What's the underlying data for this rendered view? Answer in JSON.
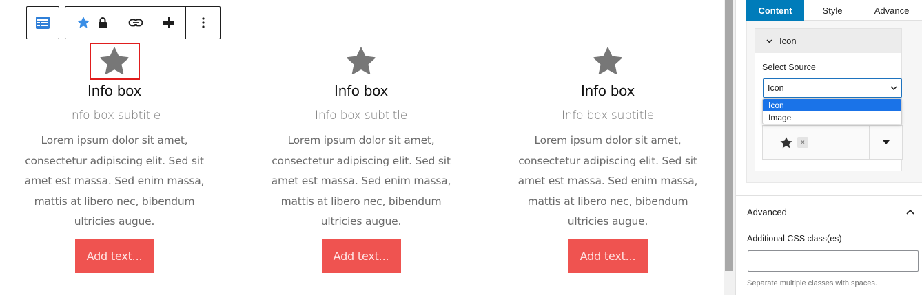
{
  "toolbar": {
    "block_icon": "block-table-icon",
    "buttons": [
      "star-icon",
      "lock-icon",
      "link-icon",
      "align-icon",
      "more-vertical-icon"
    ]
  },
  "infoboxes": [
    {
      "title": "Info box",
      "subtitle": "Info box subtitle",
      "description": "Lorem ipsum dolor sit amet, consectetur adipiscing elit. Sed sit amet est massa. Sed enim massa, mattis at libero nec, bibendum ultricies augue.",
      "button_label": "Add text...",
      "selected": true
    },
    {
      "title": "Info box",
      "subtitle": "Info box subtitle",
      "description": "Lorem ipsum dolor sit amet, consectetur adipiscing elit. Sed sit amet est massa. Sed enim massa, mattis at libero nec, bibendum ultricies augue.",
      "button_label": "Add text...",
      "selected": false
    },
    {
      "title": "Info box",
      "subtitle": "Info box subtitle",
      "description": "Lorem ipsum dolor sit amet, consectetur adipiscing elit. Sed sit amet est massa. Sed enim massa, mattis at libero nec, bibendum ultricies augue.",
      "button_label": "Add text...",
      "selected": false
    }
  ],
  "sidebar": {
    "tabs": [
      {
        "label": "Content",
        "active": true
      },
      {
        "label": "Style",
        "active": false
      },
      {
        "label": "Advance",
        "active": false
      }
    ],
    "icon_section": {
      "title": "Icon",
      "select_label": "Select Source",
      "select_value": "Icon",
      "options": [
        "Icon",
        "Image"
      ],
      "highlighted_option": "Icon",
      "clear_label": "×"
    },
    "advanced": {
      "title": "Advanced",
      "css_label": "Additional CSS class(es)",
      "css_value": "",
      "css_help": "Separate multiple classes with spaces."
    }
  },
  "colors": {
    "accent": "#007cba",
    "button_bg": "#ef5350",
    "selection_border": "#e01e1e",
    "star_gray": "#777777",
    "toolbar_star": "#3a8ee6"
  }
}
